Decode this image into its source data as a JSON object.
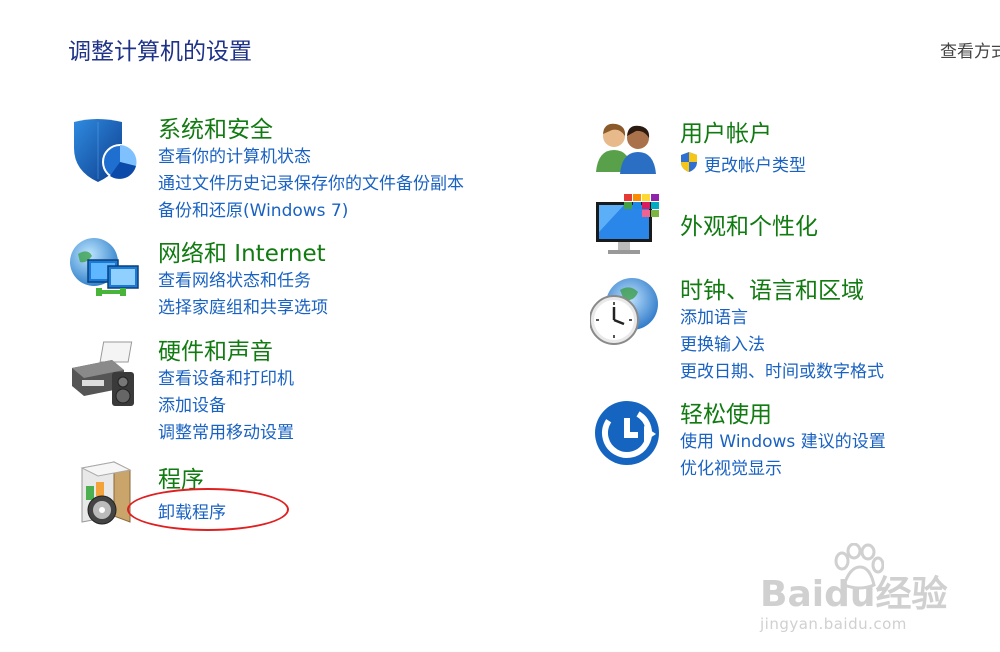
{
  "header": {
    "title": "调整计算机的设置",
    "view_by_label": "查看方式"
  },
  "categories": [
    {
      "title": "系统和安全",
      "icon": "security-shield-icon",
      "links": [
        "查看你的计算机状态",
        "通过文件历史记录保存你的文件备份副本",
        "备份和还原(Windows 7)"
      ]
    },
    {
      "title": "网络和 Internet",
      "icon": "network-globe-icon",
      "links": [
        "查看网络状态和任务",
        "选择家庭组和共享选项"
      ]
    },
    {
      "title": "硬件和声音",
      "icon": "printer-speaker-icon",
      "links": [
        "查看设备和打印机",
        "添加设备",
        "调整常用移动设置"
      ]
    },
    {
      "title": "程序",
      "icon": "programs-box-icon",
      "links": [
        "卸载程序"
      ]
    },
    {
      "title": "用户帐户",
      "icon": "users-icon",
      "links": [
        "更改帐户类型"
      ]
    },
    {
      "title": "外观和个性化",
      "icon": "monitor-palette-icon",
      "links": []
    },
    {
      "title": "时钟、语言和区域",
      "icon": "clock-globe-icon",
      "links": [
        "添加语言",
        "更换输入法",
        "更改日期、时间或数字格式"
      ]
    },
    {
      "title": "轻松使用",
      "icon": "ease-of-access-icon",
      "links": [
        "使用 Windows 建议的设置",
        "优化视觉显示"
      ]
    }
  ],
  "watermark": {
    "brand": "Baidu经验",
    "url": "jingyan.baidu.com"
  },
  "colors": {
    "title_blue": "#1e3287",
    "category_green": "#117a11",
    "link_blue": "#1a62c2",
    "annotation_red": "#e02020"
  }
}
